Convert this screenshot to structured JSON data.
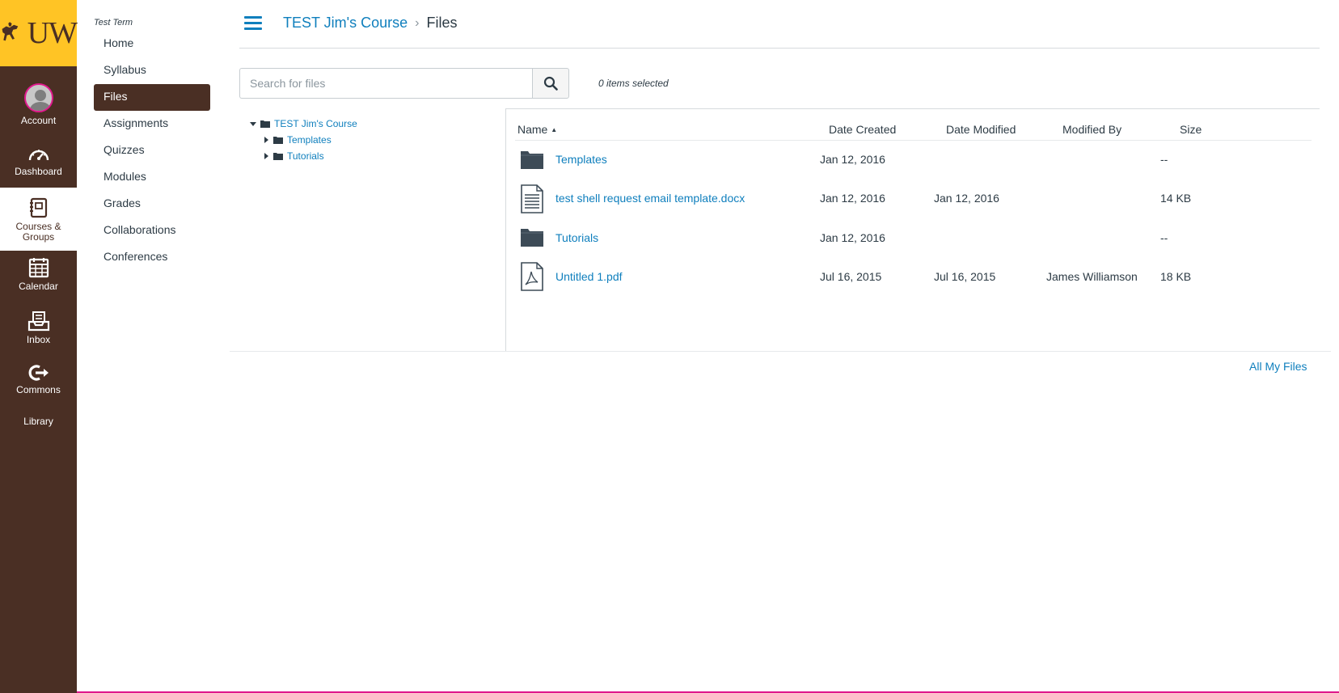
{
  "logo": {
    "text": "UW"
  },
  "global_nav": [
    {
      "id": "account",
      "label": "Account",
      "icon": "avatar-icon"
    },
    {
      "id": "dashboard",
      "label": "Dashboard",
      "icon": "dashboard-icon"
    },
    {
      "id": "courses",
      "label": "Courses &",
      "label2": "Groups",
      "icon": "courses-icon",
      "active": true
    },
    {
      "id": "calendar",
      "label": "Calendar",
      "icon": "calendar-icon"
    },
    {
      "id": "inbox",
      "label": "Inbox",
      "icon": "inbox-icon"
    },
    {
      "id": "commons",
      "label": "Commons",
      "icon": "commons-icon"
    },
    {
      "id": "library",
      "label": "Library"
    }
  ],
  "course_nav": {
    "term": "Test Term",
    "items": [
      {
        "label": "Home"
      },
      {
        "label": "Syllabus"
      },
      {
        "label": "Files",
        "active": true
      },
      {
        "label": "Assignments"
      },
      {
        "label": "Quizzes"
      },
      {
        "label": "Modules"
      },
      {
        "label": "Grades"
      },
      {
        "label": "Collaborations"
      },
      {
        "label": "Conferences"
      }
    ]
  },
  "breadcrumb": {
    "course": "TEST Jim's Course",
    "separator": "›",
    "current": "Files"
  },
  "search": {
    "placeholder": "Search for files",
    "value": ""
  },
  "selection": {
    "status": "0 items selected"
  },
  "tree": {
    "root": "TEST Jim's Course",
    "children": [
      "Templates",
      "Tutorials"
    ]
  },
  "table": {
    "columns": {
      "name": "Name",
      "sort_indicator": "▲",
      "date_created": "Date Created",
      "date_modified": "Date Modified",
      "modified_by": "Modified By",
      "size": "Size"
    },
    "rows": [
      {
        "type": "folder",
        "name": "Templates",
        "date_created": "Jan 12, 2016",
        "date_modified": "",
        "modified_by": "",
        "size": "--"
      },
      {
        "type": "document",
        "name": "test shell request email template.docx",
        "date_created": "Jan 12, 2016",
        "date_modified": "Jan 12, 2016",
        "modified_by": "",
        "size": "14 KB"
      },
      {
        "type": "folder",
        "name": "Tutorials",
        "date_created": "Jan 12, 2016",
        "date_modified": "",
        "modified_by": "",
        "size": "--"
      },
      {
        "type": "pdf",
        "name": "Untitled 1.pdf",
        "date_created": "Jul 16, 2015",
        "date_modified": "Jul 16, 2015",
        "modified_by": "James Williamson",
        "size": "18 KB"
      }
    ]
  },
  "footer": {
    "all_my_files": "All My Files"
  },
  "colors": {
    "brand_brown": "#4a2f24",
    "brand_gold": "#ffc425",
    "link_blue": "#0f7fbd",
    "accent_pink": "#e0198c"
  }
}
